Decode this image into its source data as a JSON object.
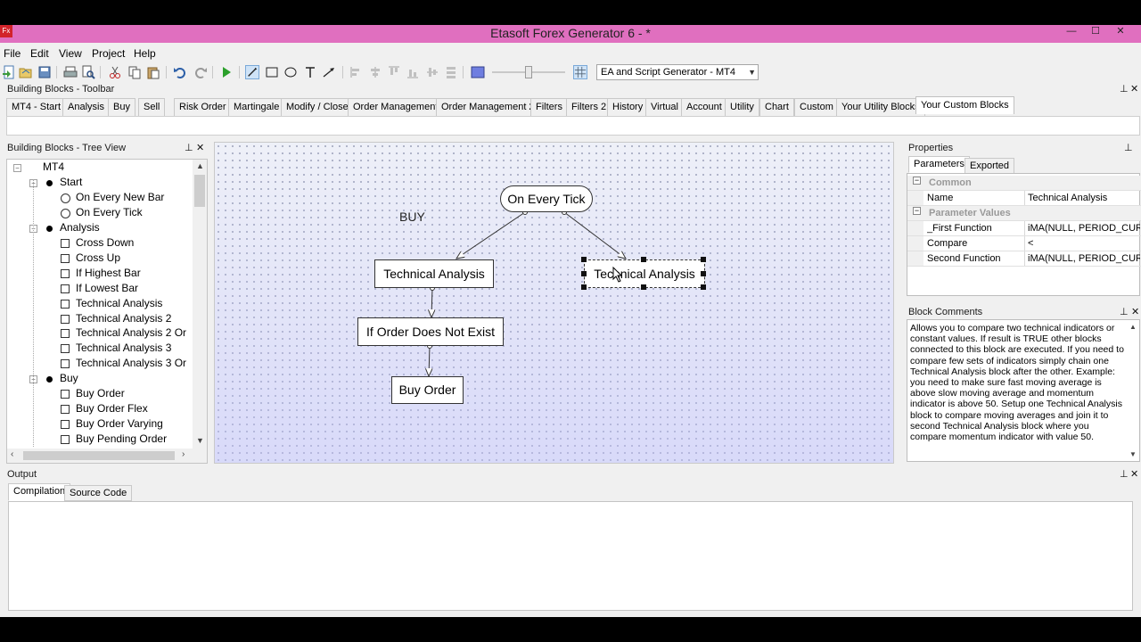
{
  "window": {
    "title": "Etasoft Forex Generator 6 - *",
    "icon_label": "Fx",
    "min_glyph": "—",
    "max_glyph": "☐",
    "close_glyph": "✕"
  },
  "menu": [
    "File",
    "Edit",
    "View",
    "Project",
    "Help"
  ],
  "toolbar": {
    "generator_select": "EA and Script Generator - MT4"
  },
  "building_blocks_toolbar": {
    "title": "Building Blocks - Toolbar",
    "tabs": [
      "MT4 - Start",
      "Analysis",
      "Buy",
      "Sell",
      "Risk Order",
      "Martingale",
      "Modify / Close",
      "Order Management",
      "Order Management 2",
      "Filters",
      "Filters 2",
      "History",
      "Virtual",
      "Account",
      "Utility",
      "Chart",
      "Custom",
      "Your Utility Blocks",
      "Your Custom Blocks"
    ],
    "active_tab": "Your Custom Blocks"
  },
  "tree_view": {
    "title": "Building Blocks - Tree View",
    "root": "MT4",
    "groups": [
      {
        "label": "Start",
        "items": [
          "On Every New Bar",
          "On Every Tick"
        ]
      },
      {
        "label": "Analysis",
        "items": [
          "Cross Down",
          "Cross Up",
          "If Highest Bar",
          "If Lowest Bar",
          "Technical Analysis",
          "Technical Analysis 2",
          "Technical Analysis 2 Or",
          "Technical Analysis 3",
          "Technical Analysis 3 Or"
        ]
      },
      {
        "label": "Buy",
        "items": [
          "Buy Order",
          "Buy Order Flex",
          "Buy Order Varying",
          "Buy Pending Order"
        ]
      }
    ]
  },
  "canvas": {
    "label": "BUY",
    "nodes": {
      "on_every_tick": "On Every Tick",
      "tech_analysis_1": "Technical Analysis",
      "tech_analysis_2": "Technical Analysis",
      "if_order": "If Order Does Not Exist",
      "buy_order": "Buy Order"
    }
  },
  "properties": {
    "title": "Properties",
    "tabs": [
      "Parameters",
      "Exported"
    ],
    "sections": {
      "common": "Common",
      "parameter_values": "Parameter Values"
    },
    "rows": [
      {
        "name": "Name",
        "value": "Technical Analysis"
      },
      {
        "name": "_First Function",
        "value": "iMA(NULL, PERIOD_CURRENT"
      },
      {
        "name": "Compare",
        "value": "<"
      },
      {
        "name": "Second Function",
        "value": "iMA(NULL, PERIOD_CURRENT"
      }
    ]
  },
  "block_comments": {
    "title": "Block Comments",
    "text": "Allows you to compare two technical indicators or constant values. If result is TRUE other blocks connected to this block are executed. If you need to compare few sets of indicators simply chain one Technical Analysis block after the other. Example: you need to make sure fast moving average is above slow moving average and momentum indicator is above 50. Setup one Technical Analysis block to compare moving averages and join it to second Technical Analysis block where you compare momentum indicator with value 50."
  },
  "output": {
    "title": "Output",
    "tabs": [
      "Compilation",
      "Source Code"
    ]
  },
  "colors": {
    "titlebar": "#e06fbf",
    "canvas_bottom": "#c8c8fa"
  }
}
